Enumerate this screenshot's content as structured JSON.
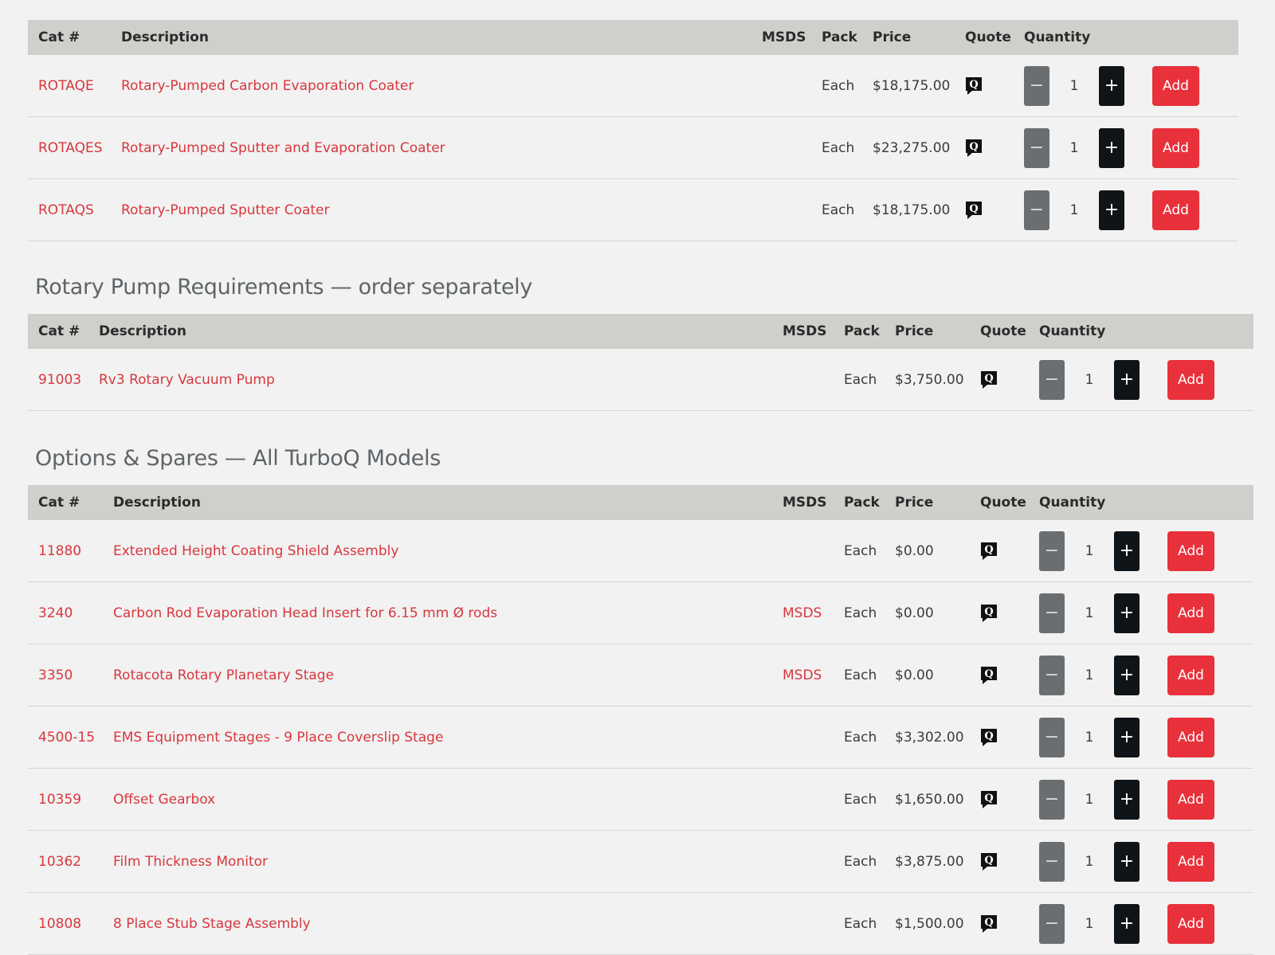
{
  "colors": {
    "accent_red": "#e8313b",
    "link_red": "#d8373f",
    "header_bg": "#cfcfcc",
    "page_bg": "#f1f2f1",
    "plus_button": "#0f1419",
    "minus_button": "#6b6e71"
  },
  "columns": {
    "cat": "Cat #",
    "description": "Description",
    "msds": "MSDS",
    "pack": "Pack",
    "price": "Price",
    "quote": "Quote",
    "quantity": "Quantity"
  },
  "icons": {
    "quote": "quote-speech-bubble-icon",
    "minus": "minus-icon",
    "plus": "plus-icon"
  },
  "add_label": "Add",
  "sections": [
    {
      "title": "",
      "rows": [
        {
          "cat": "ROTAQE",
          "description": "Rotary-Pumped Carbon Evaporation Coater",
          "msds": "",
          "pack": "Each",
          "price": "$18,175.00",
          "quantity": "1"
        },
        {
          "cat": "ROTAQES",
          "description": "Rotary-Pumped Sputter and Evaporation Coater",
          "msds": "",
          "pack": "Each",
          "price": "$23,275.00",
          "quantity": "1"
        },
        {
          "cat": "ROTAQS",
          "description": "Rotary-Pumped Sputter Coater",
          "msds": "",
          "pack": "Each",
          "price": "$18,175.00",
          "quantity": "1"
        }
      ]
    },
    {
      "title": "Rotary Pump Requirements — order separately",
      "rows": [
        {
          "cat": "91003",
          "description": "Rv3 Rotary Vacuum Pump",
          "msds": "",
          "pack": "Each",
          "price": "$3,750.00",
          "quantity": "1"
        }
      ]
    },
    {
      "title": "Options & Spares — All TurboQ Models",
      "rows": [
        {
          "cat": "11880",
          "description": "Extended Height Coating Shield Assembly",
          "msds": "",
          "pack": "Each",
          "price": "$0.00",
          "quantity": "1"
        },
        {
          "cat": "3240",
          "description": "Carbon Rod Evaporation Head Insert for 6.15 mm Ø rods",
          "msds": "MSDS",
          "pack": "Each",
          "price": "$0.00",
          "quantity": "1"
        },
        {
          "cat": "3350",
          "description": "Rotacota Rotary Planetary Stage",
          "msds": "MSDS",
          "pack": "Each",
          "price": "$0.00",
          "quantity": "1"
        },
        {
          "cat": "4500-15",
          "description": "EMS Equipment Stages - 9 Place Coverslip Stage",
          "msds": "",
          "pack": "Each",
          "price": "$3,302.00",
          "quantity": "1"
        },
        {
          "cat": "10359",
          "description": "Offset Gearbox",
          "msds": "",
          "pack": "Each",
          "price": "$1,650.00",
          "quantity": "1"
        },
        {
          "cat": "10362",
          "description": "Film Thickness Monitor",
          "msds": "",
          "pack": "Each",
          "price": "$3,875.00",
          "quantity": "1"
        },
        {
          "cat": "10808",
          "description": "8 Place Stub Stage Assembly",
          "msds": "",
          "pack": "Each",
          "price": "$1,500.00",
          "quantity": "1"
        }
      ]
    }
  ]
}
